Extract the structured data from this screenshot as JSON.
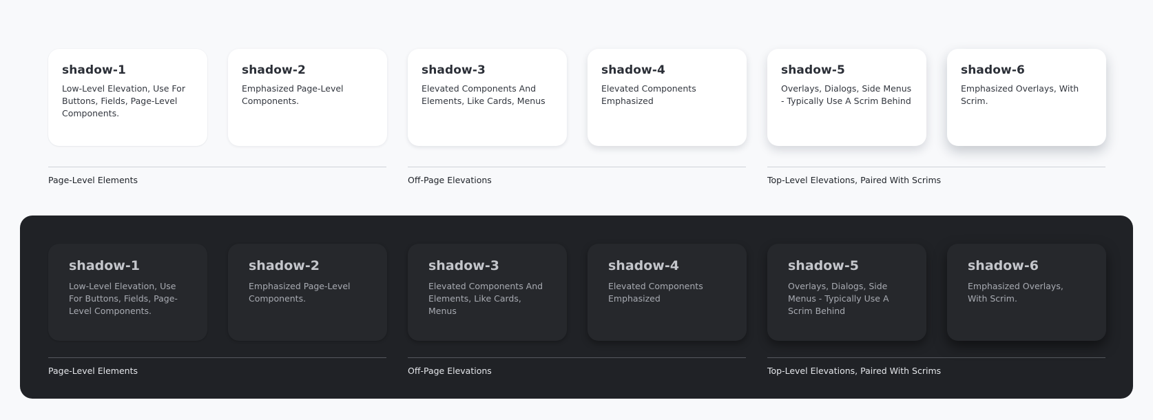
{
  "light": {
    "cards": [
      {
        "title": "shadow-1",
        "description": "Low-Level Elevation, Use For Buttons, Fields, Page-Level Components."
      },
      {
        "title": "shadow-2",
        "description": "Emphasized Page-Level Components."
      },
      {
        "title": "shadow-3",
        "description": "Elevated Components And Elements, Like Cards, Menus"
      },
      {
        "title": "shadow-4",
        "description": "Elevated Components Emphasized"
      },
      {
        "title": "shadow-5",
        "description": "Overlays, Dialogs, Side Menus - Typically Use A Scrim Behind"
      },
      {
        "title": "shadow-6",
        "description": "Emphasized Overlays, With Scrim."
      }
    ],
    "groups": [
      "Page-Level Elements",
      "Off-Page Elevations",
      "Top-Level Elevations, Paired With Scrims"
    ]
  },
  "dark": {
    "cards": [
      {
        "title": "shadow-1",
        "description": "Low-Level Elevation, Use For Buttons, Fields, Page-Level Components."
      },
      {
        "title": "shadow-2",
        "description": "Emphasized Page-Level Components."
      },
      {
        "title": "shadow-3",
        "description": "Elevated Components And Elements, Like Cards, Menus"
      },
      {
        "title": "shadow-4",
        "description": "Elevated Components Emphasized"
      },
      {
        "title": "shadow-5",
        "description": "Overlays, Dialogs, Side Menus - Typically Use A Scrim Behind"
      },
      {
        "title": "shadow-6",
        "description": "Emphasized Overlays, With Scrim."
      }
    ],
    "groups": [
      "Page-Level Elements",
      "Off-Page Elevations",
      "Top-Level Elevations, Paired With Scrims"
    ]
  },
  "colors": {
    "page_background": "#f8f9fb",
    "light_card": "#ffffff",
    "dark_panel": "#202226",
    "dark_card": "#26282c"
  }
}
